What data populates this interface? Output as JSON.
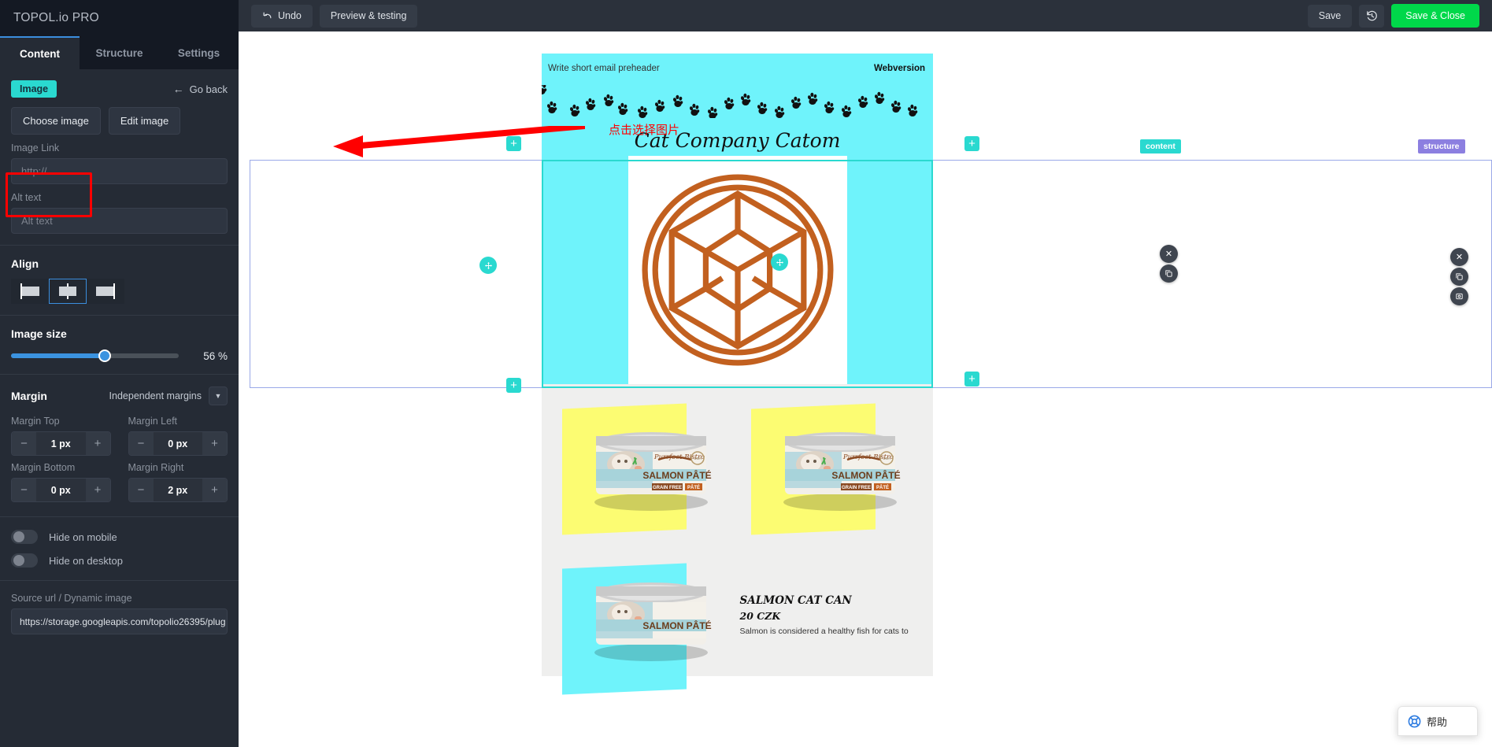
{
  "sidebar": {
    "brand": "TOPOL.io PRO",
    "tabs": [
      {
        "label": "Content",
        "active": true
      },
      {
        "label": "Structure",
        "active": false
      },
      {
        "label": "Settings",
        "active": false
      }
    ],
    "block_chip": "Image",
    "go_back": "Go back",
    "go_back_arrow": "←",
    "choose_image": "Choose image",
    "edit_image": "Edit image",
    "image_link": {
      "label": "Image Link",
      "value": "",
      "placeholder": "http://"
    },
    "alt_text": {
      "label": "Alt text",
      "value": "",
      "placeholder": "Alt text"
    },
    "align": {
      "title": "Align",
      "options": [
        "align-left",
        "align-center",
        "align-right"
      ],
      "selected": "align-center"
    },
    "image_size": {
      "title": "Image size",
      "value": 56,
      "value_label": "56 %"
    },
    "margin": {
      "title": "Margin",
      "mode_label": "Independent margins",
      "fields": [
        {
          "label": "Margin Top",
          "value": "1 px"
        },
        {
          "label": "Margin Left",
          "value": "0 px"
        },
        {
          "label": "Margin Bottom",
          "value": "0 px"
        },
        {
          "label": "Margin Right",
          "value": "2 px"
        }
      ],
      "minus": "−",
      "plus": "+"
    },
    "toggles": [
      {
        "label": "Hide on mobile",
        "on": false
      },
      {
        "label": "Hide on desktop",
        "on": false
      }
    ],
    "source_url": {
      "label": "Source url / Dynamic image",
      "value": "https://storage.googleapis.com/topolio26395/plug"
    }
  },
  "toolbar": {
    "undo": "Undo",
    "preview": "Preview & testing",
    "save": "Save",
    "history_icon": "history-icon",
    "save_close": "Save & Close",
    "accent_green": "#00d84a"
  },
  "annotation": {
    "text": "点击选择图片",
    "color": "#ff0000"
  },
  "email": {
    "preheader": "Write short email preheader",
    "webversion": "Webversion",
    "title": "Cat Company Catom",
    "header_bg": "#6ff3fb",
    "logo_color": "#c2601f",
    "product": {
      "title": "SALMON CAT CAN",
      "price": "20 CZK",
      "desc": "Salmon is considered a healthy fish for cats to"
    },
    "can_label": {
      "brand": "Purrfect Bistro",
      "flavor": "SALMON PÂTÉ",
      "badge1": "GRAIN FREE",
      "badge2": "PÂTÉ"
    }
  },
  "overlays": {
    "content_tag": "content",
    "structure_tag": "structure",
    "plus": "+",
    "close": "✕",
    "duplicate": "duplicate-icon",
    "settings": "settings-icon",
    "move": "move-icon",
    "content_color": "#2ad9d0",
    "structure_color": "#8c7fe0"
  },
  "help": {
    "label": "帮助",
    "icon": "lifebuoy-icon"
  }
}
